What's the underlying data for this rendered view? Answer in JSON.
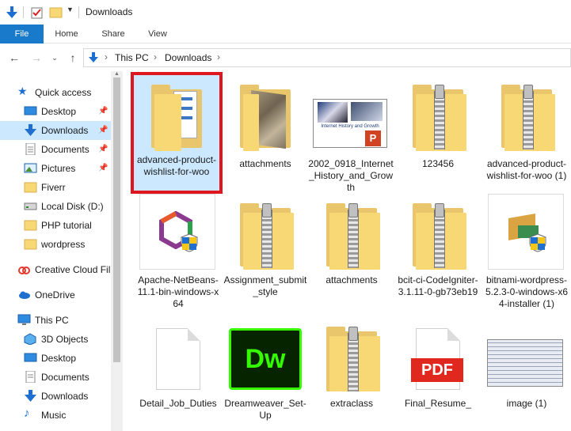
{
  "window": {
    "title": "Downloads"
  },
  "ribbon": {
    "tabs": [
      "File",
      "Home",
      "Share",
      "View"
    ]
  },
  "address": {
    "crumbs": [
      "This PC",
      "Downloads"
    ]
  },
  "nav": {
    "quick_access": "Quick access",
    "items": [
      {
        "label": "Desktop",
        "icon": "desktop-icon",
        "pinned": true
      },
      {
        "label": "Downloads",
        "icon": "download-arrow-icon",
        "pinned": true,
        "selected": true
      },
      {
        "label": "Documents",
        "icon": "documents-icon",
        "pinned": true
      },
      {
        "label": "Pictures",
        "icon": "pictures-icon",
        "pinned": true
      },
      {
        "label": "Fiverr",
        "icon": "folder-icon"
      },
      {
        "label": "Local Disk (D:)",
        "icon": "drive-icon"
      },
      {
        "label": "PHP tutorial",
        "icon": "folder-icon"
      },
      {
        "label": "wordpress",
        "icon": "folder-icon"
      }
    ],
    "creative_cloud": "Creative Cloud Fil",
    "onedrive": "OneDrive",
    "this_pc": "This PC",
    "pc_items": [
      {
        "label": "3D Objects",
        "icon": "3d-objects-icon"
      },
      {
        "label": "Desktop",
        "icon": "desktop-icon"
      },
      {
        "label": "Documents",
        "icon": "documents-icon"
      },
      {
        "label": "Downloads",
        "icon": "download-arrow-icon"
      },
      {
        "label": "Music",
        "icon": "music-icon"
      }
    ]
  },
  "files": [
    {
      "label": "advanced-product-wishlist-for-woo",
      "type": "folder-docs",
      "selected": true
    },
    {
      "label": "attachments",
      "type": "folder-photo"
    },
    {
      "label": "2002_0918_Internet_History_and_Growth",
      "type": "pptx"
    },
    {
      "label": "123456",
      "type": "zip"
    },
    {
      "label": "advanced-product-wishlist-for-woo (1)",
      "type": "zip"
    },
    {
      "label": "Apache-NetBeans-11.1-bin-windows-x64",
      "type": "installer-netbeans"
    },
    {
      "label": "Assignment_submit_style",
      "type": "zip"
    },
    {
      "label": "attachments",
      "type": "zip"
    },
    {
      "label": "bcit-ci-CodeIgniter-3.1.11-0-gb73eb19",
      "type": "zip"
    },
    {
      "label": "bitnami-wordpress-5.2.3-0-windows-x64-installer (1)",
      "type": "installer-bitnami"
    },
    {
      "label": "Detail_Job_Duties",
      "type": "doc"
    },
    {
      "label": "Dreamweaver_Set-Up",
      "type": "dreamweaver"
    },
    {
      "label": "extraclass",
      "type": "zip"
    },
    {
      "label": "Final_Resume_",
      "type": "pdf"
    },
    {
      "label": "image (1)",
      "type": "image"
    }
  ],
  "pptx": {
    "slide_title": "Internet History and Growth",
    "badge": "P"
  },
  "dw": {
    "text": "Dw"
  },
  "pdf": {
    "text": "PDF"
  },
  "colors": {
    "file_tab": "#1979ca",
    "selection": "#cce8ff",
    "highlight_border": "#e0161e",
    "folder": "#f8d775"
  }
}
